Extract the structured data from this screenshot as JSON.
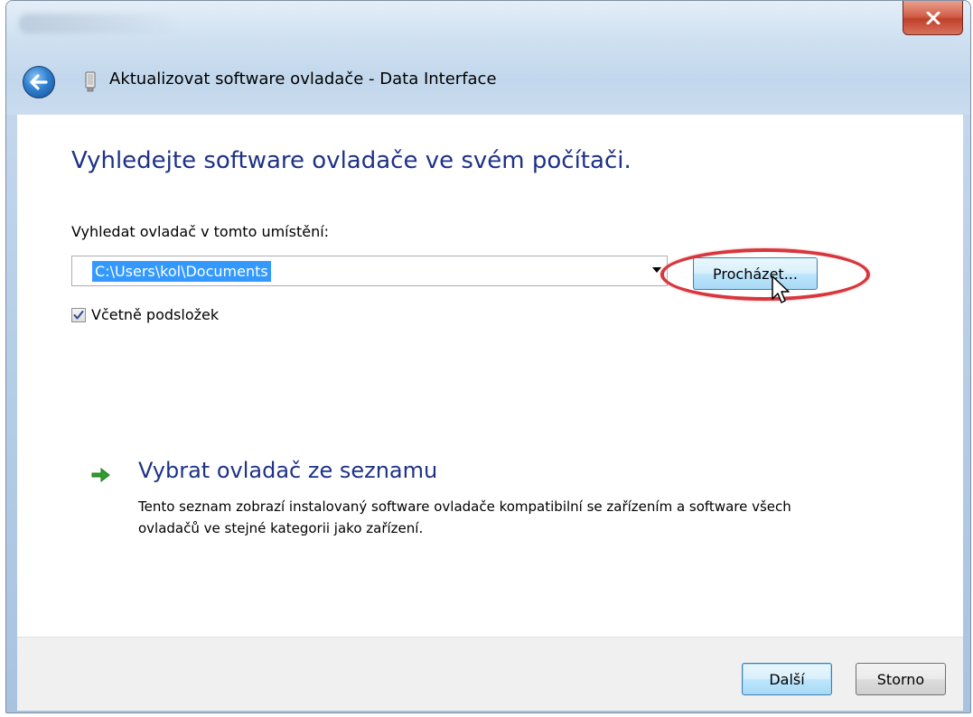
{
  "window": {
    "title": "Aktualizovat software ovladače - Data Interface",
    "close_icon": "close-x-icon",
    "back_icon": "back-arrow-icon"
  },
  "main": {
    "heading": "Vyhledejte software ovladače ve svém počítači.",
    "location_label": "Vyhledat ovladač v tomto umístění:",
    "location_value": "C:\\Users\\kol\\Documents",
    "browse_label": "Procházet...",
    "include_subfolders_label": "Včetně podsložek",
    "include_subfolders_checked": true
  },
  "pick_from_list": {
    "title": "Vybrat ovladač ze seznamu",
    "description": "Tento seznam zobrazí instalovaný software ovladače kompatibilní se zařízením a software všech ovladačů ve stejné kategorii jako zařízení."
  },
  "footer": {
    "next_label": "Další",
    "cancel_label": "Storno"
  },
  "colors": {
    "heading": "#1e3287",
    "highlight_ring": "#d7373c",
    "selection": "#3399ff"
  }
}
